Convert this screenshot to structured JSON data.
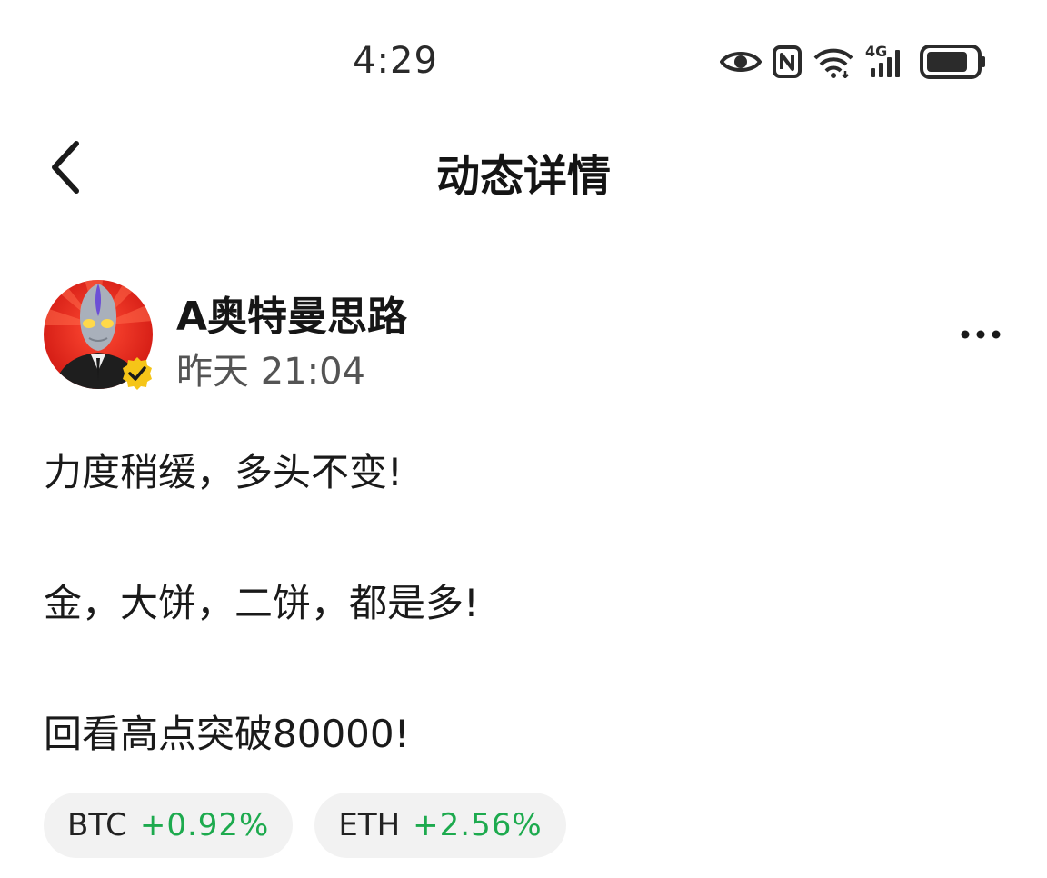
{
  "status_bar": {
    "time": "4:29",
    "icons": [
      "eye-icon",
      "nfc-icon",
      "wifi-icon",
      "signal-4g-icon",
      "battery-icon"
    ],
    "network_label": "4G"
  },
  "header": {
    "title": "动态详情",
    "back_icon": "chevron-left-icon"
  },
  "post": {
    "author": {
      "name": "A奥特曼思路",
      "verified": true,
      "avatar_icon": "avatar-image"
    },
    "time": "昨天 21:04",
    "more_icon": "more-horizontal-icon",
    "lines": [
      "力度稍缓，多头不变!",
      "金，大饼，二饼，都是多!",
      "回看高点突破80000!"
    ],
    "tickers": [
      {
        "symbol": "BTC",
        "change": "+0.92%"
      },
      {
        "symbol": "ETH",
        "change": "+2.56%"
      }
    ]
  },
  "colors": {
    "positive": "#1daa4e",
    "chip_background": "#f2f2f2",
    "verified_badge": "#f5c518",
    "avatar_background": "#e0241b"
  }
}
